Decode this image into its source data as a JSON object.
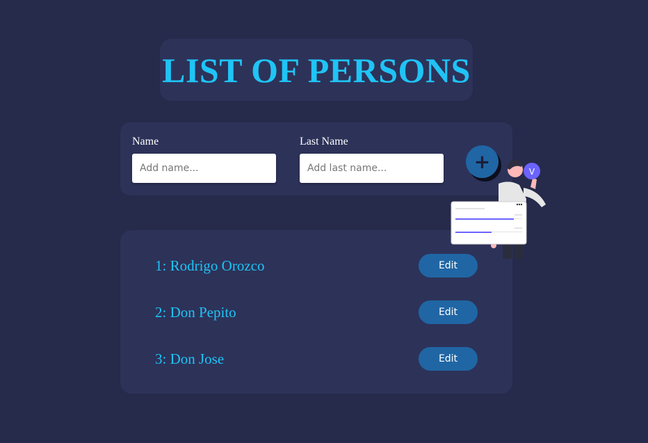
{
  "header": {
    "title": "LIST OF PERSONS"
  },
  "form": {
    "name_label": "Name",
    "name_placeholder": "Add name...",
    "last_name_label": "Last Name",
    "last_name_placeholder": "Add last name...",
    "add_button_symbol": "+"
  },
  "persons": [
    {
      "label": "1: Rodrigo Orozco",
      "edit_label": "Edit"
    },
    {
      "label": "2: Don Pepito",
      "edit_label": "Edit"
    },
    {
      "label": "3: Don Jose",
      "edit_label": "Edit"
    }
  ],
  "illustration": {
    "badge_letter": "V",
    "icon": "person-with-checklist-illustration"
  },
  "colors": {
    "background": "#262a4b",
    "card": "#2d3259",
    "accent_text": "#1fc4f5",
    "button": "#2066a4",
    "badge": "#6c63ff"
  }
}
